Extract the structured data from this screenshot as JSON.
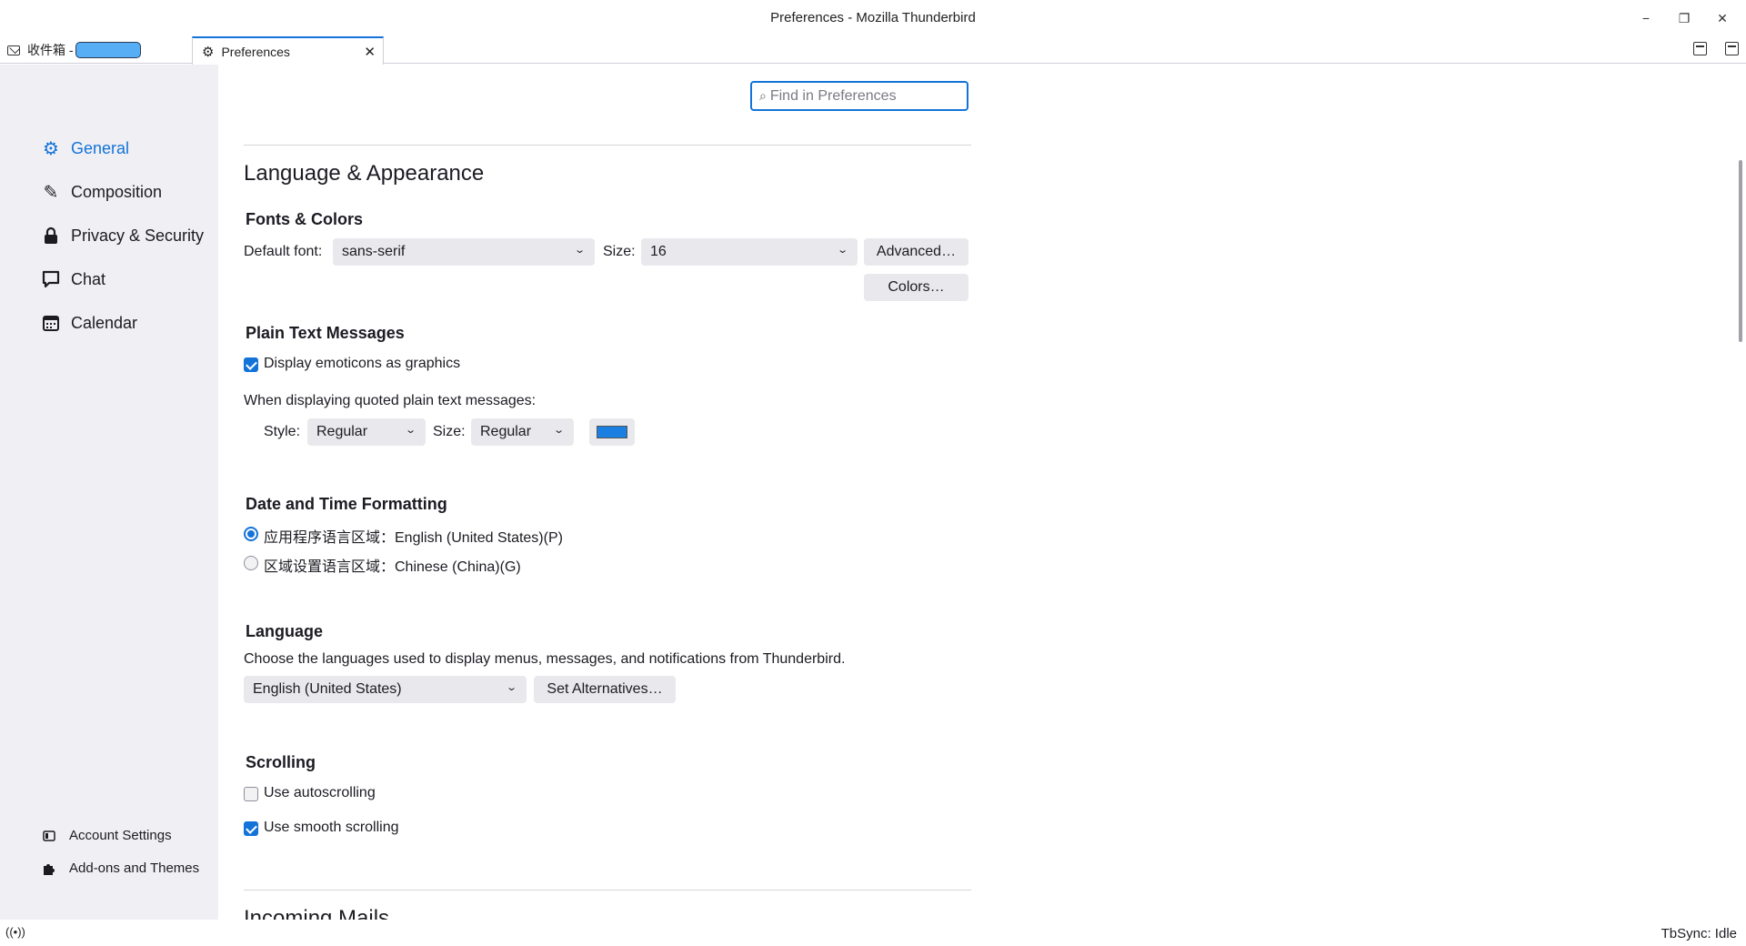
{
  "window": {
    "title": "Preferences - Mozilla Thunderbird",
    "minimize": "−",
    "restore": "❐",
    "close": "✕"
  },
  "tabs": [
    {
      "label": "收件箱 -",
      "icon": "mail-icon"
    },
    {
      "label": "Preferences",
      "icon": "gear-icon",
      "close": "✕"
    }
  ],
  "sidebar": {
    "categories": [
      {
        "label": "General",
        "icon": "gear-icon",
        "selected": true
      },
      {
        "label": "Composition",
        "icon": "pencil-icon"
      },
      {
        "label": "Privacy & Security",
        "icon": "lock-icon"
      },
      {
        "label": "Chat",
        "icon": "chat-bubble-icon"
      },
      {
        "label": "Calendar",
        "icon": "calendar-icon"
      }
    ],
    "bottom": [
      {
        "label": "Account Settings",
        "icon": "account-icon"
      },
      {
        "label": "Add-ons and Themes",
        "icon": "puzzle-icon"
      }
    ]
  },
  "search": {
    "placeholder": "Find in Preferences"
  },
  "language_appearance": {
    "heading": "Language & Appearance",
    "fonts_colors": {
      "heading": "Fonts & Colors",
      "default_font_label": "Default font:",
      "default_font_value": "sans-serif",
      "size_label": "Size:",
      "size_value": "16",
      "advanced_label": "Advanced…",
      "colors_label": "Colors…"
    },
    "plain_text": {
      "heading": "Plain Text Messages",
      "emoticons_label": "Display emoticons as graphics",
      "emoticons_checked": true,
      "quoted_label": "When displaying quoted plain text messages:",
      "style_label": "Style:",
      "style_value": "Regular",
      "size_label": "Size:",
      "size_value": "Regular",
      "quote_color": "#1a7fe0"
    },
    "datetime": {
      "heading": "Date and Time Formatting",
      "option_app": "应用程序语言区域：English (United States)(P)",
      "option_regional": "区域设置语言区域：Chinese (China)(G)",
      "selected": "app"
    },
    "language": {
      "heading": "Language",
      "description": "Choose the languages used to display menus, messages, and notifications from Thunderbird.",
      "value": "English (United States)",
      "set_alternatives_label": "Set Alternatives…"
    },
    "scrolling": {
      "heading": "Scrolling",
      "autoscroll_label": "Use autoscrolling",
      "autoscroll_checked": false,
      "smooth_label": "Use smooth scrolling",
      "smooth_checked": true
    }
  },
  "next_section": {
    "heading": "Incoming Mails"
  },
  "status": {
    "left_icon": "broadcast-icon",
    "right": "TbSync: Idle"
  },
  "colors": {
    "accent": "#1373d9",
    "sidebar_bg": "#f0f0f4",
    "control_bg": "#e9e9ed"
  }
}
